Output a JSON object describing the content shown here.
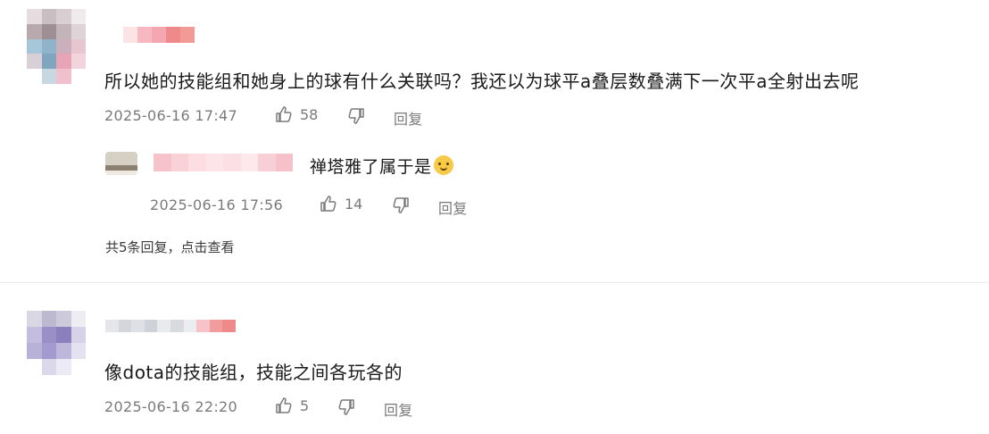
{
  "comments": [
    {
      "text": "所以她的技能组和她身上的球有什么关联吗？我还以为球平a叠层数叠满下一次平a全射出去呢",
      "timestamp": "2025-06-16 17:47",
      "likes": "58",
      "reply_label": "回复",
      "reply": {
        "text": "禅塔雅了属于是",
        "emoji_icon": "smiling-cat-emoji",
        "timestamp": "2025-06-16 17:56",
        "likes": "14",
        "reply_label": "回复"
      },
      "more_replies_label": "共5条回复，点击查看"
    },
    {
      "text": "像dota的技能组，技能之间各玩各的",
      "timestamp": "2025-06-16 22:20",
      "likes": "5",
      "reply_label": "回复"
    }
  ],
  "icons": {
    "like": "thumbs-up-icon",
    "dislike": "thumbs-down-icon"
  },
  "colors": {
    "text": "#1a1a1a",
    "meta": "#7a7a7a",
    "mosaic_pink": "#f4a7b0",
    "mosaic_red": "#ee8a8a",
    "divider": "#ececec"
  }
}
